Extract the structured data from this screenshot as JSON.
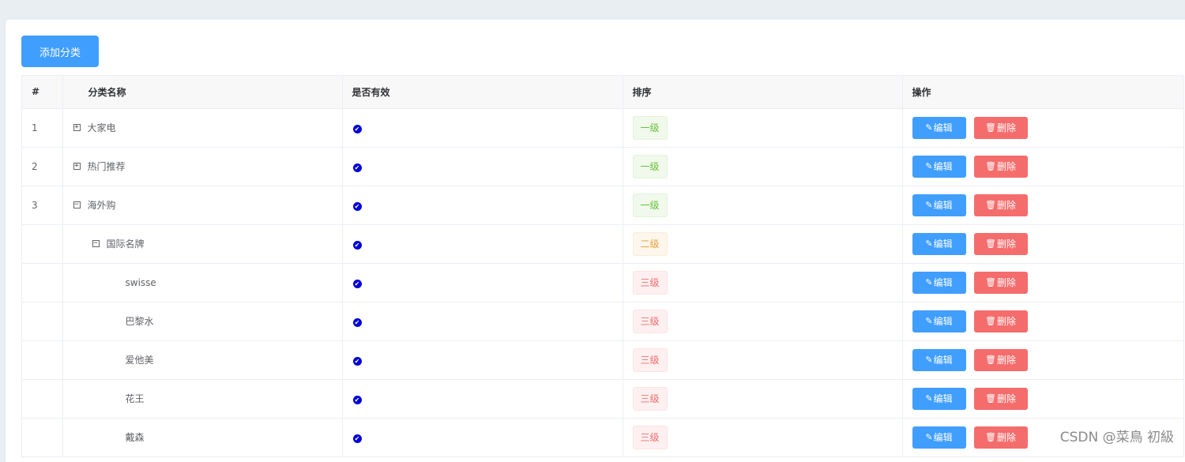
{
  "toolbar": {
    "add_label": "添加分类"
  },
  "table": {
    "headers": {
      "index": "#",
      "name": "分类名称",
      "valid": "是否有效",
      "sort": "排序",
      "ops": "操作"
    },
    "edit_label": "编辑",
    "delete_label": "删除",
    "rows": [
      {
        "index": "1",
        "name": "大家电",
        "level": 0,
        "expand": "+",
        "valid": true,
        "sort": "一级",
        "sort_color": "green"
      },
      {
        "index": "2",
        "name": "热门推荐",
        "level": 0,
        "expand": "+",
        "valid": true,
        "sort": "一级",
        "sort_color": "green"
      },
      {
        "index": "3",
        "name": "海外购",
        "level": 0,
        "expand": "−",
        "valid": true,
        "sort": "一级",
        "sort_color": "green"
      },
      {
        "index": "",
        "name": "国际名牌",
        "level": 1,
        "expand": "−",
        "valid": true,
        "sort": "二级",
        "sort_color": "orange"
      },
      {
        "index": "",
        "name": "swisse",
        "level": 2,
        "expand": "",
        "valid": true,
        "sort": "三级",
        "sort_color": "red"
      },
      {
        "index": "",
        "name": "巴黎水",
        "level": 2,
        "expand": "",
        "valid": true,
        "sort": "三级",
        "sort_color": "red"
      },
      {
        "index": "",
        "name": "爱他美",
        "level": 2,
        "expand": "",
        "valid": true,
        "sort": "三级",
        "sort_color": "red"
      },
      {
        "index": "",
        "name": "花王",
        "level": 2,
        "expand": "",
        "valid": true,
        "sort": "三级",
        "sort_color": "red"
      },
      {
        "index": "",
        "name": "戴森",
        "level": 2,
        "expand": "",
        "valid": true,
        "sort": "三级",
        "sort_color": "red"
      }
    ]
  },
  "watermark": "CSDN @菜鳥 初級"
}
